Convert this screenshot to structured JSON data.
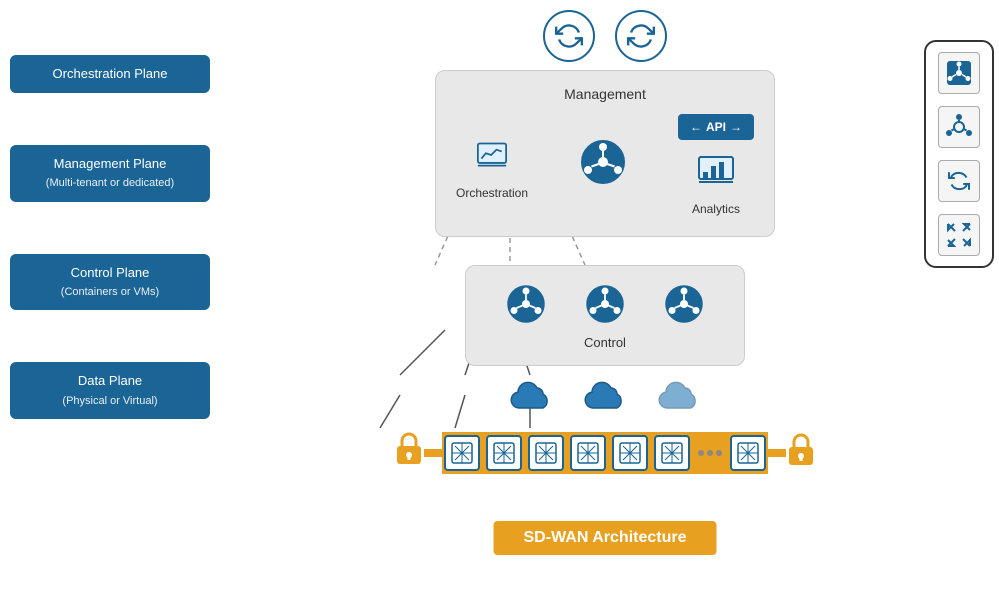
{
  "labels": [
    {
      "id": "orchestration-plane",
      "text": "Orchestration Plane",
      "sub": null
    },
    {
      "id": "management-plane",
      "text": "Management Plane",
      "sub": "(Multi-tenant or dedicated)"
    },
    {
      "id": "control-plane",
      "text": "Control Plane",
      "sub": "(Containers or VMs)"
    },
    {
      "id": "data-plane",
      "text": "Data Plane",
      "sub": "(Physical or Virtual)"
    }
  ],
  "management_box": {
    "title": "Management",
    "orchestration_label": "Orchestration",
    "analytics_label": "Analytics",
    "api_label": "API"
  },
  "control_box": {
    "title": "Control"
  },
  "bottom_title": "SD-WAN Architecture",
  "icons": {
    "sync": "🔄",
    "sync2": "🔁",
    "chart": "📊",
    "hub": "🔘",
    "cloud": "☁",
    "lock": "🔒",
    "switch": "⊞",
    "network_hub": "⊕",
    "compress": "⤡"
  }
}
